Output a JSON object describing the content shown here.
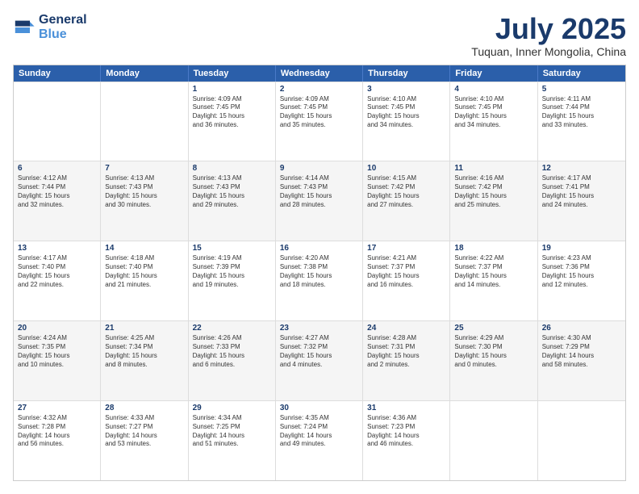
{
  "logo": {
    "line1": "General",
    "line2": "Blue"
  },
  "title": "July 2025",
  "location": "Tuquan, Inner Mongolia, China",
  "header_days": [
    "Sunday",
    "Monday",
    "Tuesday",
    "Wednesday",
    "Thursday",
    "Friday",
    "Saturday"
  ],
  "rows": [
    {
      "alt": false,
      "cells": [
        {
          "day": "",
          "text": ""
        },
        {
          "day": "",
          "text": ""
        },
        {
          "day": "1",
          "text": "Sunrise: 4:09 AM\nSunset: 7:45 PM\nDaylight: 15 hours\nand 36 minutes."
        },
        {
          "day": "2",
          "text": "Sunrise: 4:09 AM\nSunset: 7:45 PM\nDaylight: 15 hours\nand 35 minutes."
        },
        {
          "day": "3",
          "text": "Sunrise: 4:10 AM\nSunset: 7:45 PM\nDaylight: 15 hours\nand 34 minutes."
        },
        {
          "day": "4",
          "text": "Sunrise: 4:10 AM\nSunset: 7:45 PM\nDaylight: 15 hours\nand 34 minutes."
        },
        {
          "day": "5",
          "text": "Sunrise: 4:11 AM\nSunset: 7:44 PM\nDaylight: 15 hours\nand 33 minutes."
        }
      ]
    },
    {
      "alt": true,
      "cells": [
        {
          "day": "6",
          "text": "Sunrise: 4:12 AM\nSunset: 7:44 PM\nDaylight: 15 hours\nand 32 minutes."
        },
        {
          "day": "7",
          "text": "Sunrise: 4:13 AM\nSunset: 7:43 PM\nDaylight: 15 hours\nand 30 minutes."
        },
        {
          "day": "8",
          "text": "Sunrise: 4:13 AM\nSunset: 7:43 PM\nDaylight: 15 hours\nand 29 minutes."
        },
        {
          "day": "9",
          "text": "Sunrise: 4:14 AM\nSunset: 7:43 PM\nDaylight: 15 hours\nand 28 minutes."
        },
        {
          "day": "10",
          "text": "Sunrise: 4:15 AM\nSunset: 7:42 PM\nDaylight: 15 hours\nand 27 minutes."
        },
        {
          "day": "11",
          "text": "Sunrise: 4:16 AM\nSunset: 7:42 PM\nDaylight: 15 hours\nand 25 minutes."
        },
        {
          "day": "12",
          "text": "Sunrise: 4:17 AM\nSunset: 7:41 PM\nDaylight: 15 hours\nand 24 minutes."
        }
      ]
    },
    {
      "alt": false,
      "cells": [
        {
          "day": "13",
          "text": "Sunrise: 4:17 AM\nSunset: 7:40 PM\nDaylight: 15 hours\nand 22 minutes."
        },
        {
          "day": "14",
          "text": "Sunrise: 4:18 AM\nSunset: 7:40 PM\nDaylight: 15 hours\nand 21 minutes."
        },
        {
          "day": "15",
          "text": "Sunrise: 4:19 AM\nSunset: 7:39 PM\nDaylight: 15 hours\nand 19 minutes."
        },
        {
          "day": "16",
          "text": "Sunrise: 4:20 AM\nSunset: 7:38 PM\nDaylight: 15 hours\nand 18 minutes."
        },
        {
          "day": "17",
          "text": "Sunrise: 4:21 AM\nSunset: 7:37 PM\nDaylight: 15 hours\nand 16 minutes."
        },
        {
          "day": "18",
          "text": "Sunrise: 4:22 AM\nSunset: 7:37 PM\nDaylight: 15 hours\nand 14 minutes."
        },
        {
          "day": "19",
          "text": "Sunrise: 4:23 AM\nSunset: 7:36 PM\nDaylight: 15 hours\nand 12 minutes."
        }
      ]
    },
    {
      "alt": true,
      "cells": [
        {
          "day": "20",
          "text": "Sunrise: 4:24 AM\nSunset: 7:35 PM\nDaylight: 15 hours\nand 10 minutes."
        },
        {
          "day": "21",
          "text": "Sunrise: 4:25 AM\nSunset: 7:34 PM\nDaylight: 15 hours\nand 8 minutes."
        },
        {
          "day": "22",
          "text": "Sunrise: 4:26 AM\nSunset: 7:33 PM\nDaylight: 15 hours\nand 6 minutes."
        },
        {
          "day": "23",
          "text": "Sunrise: 4:27 AM\nSunset: 7:32 PM\nDaylight: 15 hours\nand 4 minutes."
        },
        {
          "day": "24",
          "text": "Sunrise: 4:28 AM\nSunset: 7:31 PM\nDaylight: 15 hours\nand 2 minutes."
        },
        {
          "day": "25",
          "text": "Sunrise: 4:29 AM\nSunset: 7:30 PM\nDaylight: 15 hours\nand 0 minutes."
        },
        {
          "day": "26",
          "text": "Sunrise: 4:30 AM\nSunset: 7:29 PM\nDaylight: 14 hours\nand 58 minutes."
        }
      ]
    },
    {
      "alt": false,
      "cells": [
        {
          "day": "27",
          "text": "Sunrise: 4:32 AM\nSunset: 7:28 PM\nDaylight: 14 hours\nand 56 minutes."
        },
        {
          "day": "28",
          "text": "Sunrise: 4:33 AM\nSunset: 7:27 PM\nDaylight: 14 hours\nand 53 minutes."
        },
        {
          "day": "29",
          "text": "Sunrise: 4:34 AM\nSunset: 7:25 PM\nDaylight: 14 hours\nand 51 minutes."
        },
        {
          "day": "30",
          "text": "Sunrise: 4:35 AM\nSunset: 7:24 PM\nDaylight: 14 hours\nand 49 minutes."
        },
        {
          "day": "31",
          "text": "Sunrise: 4:36 AM\nSunset: 7:23 PM\nDaylight: 14 hours\nand 46 minutes."
        },
        {
          "day": "",
          "text": ""
        },
        {
          "day": "",
          "text": ""
        }
      ]
    }
  ]
}
